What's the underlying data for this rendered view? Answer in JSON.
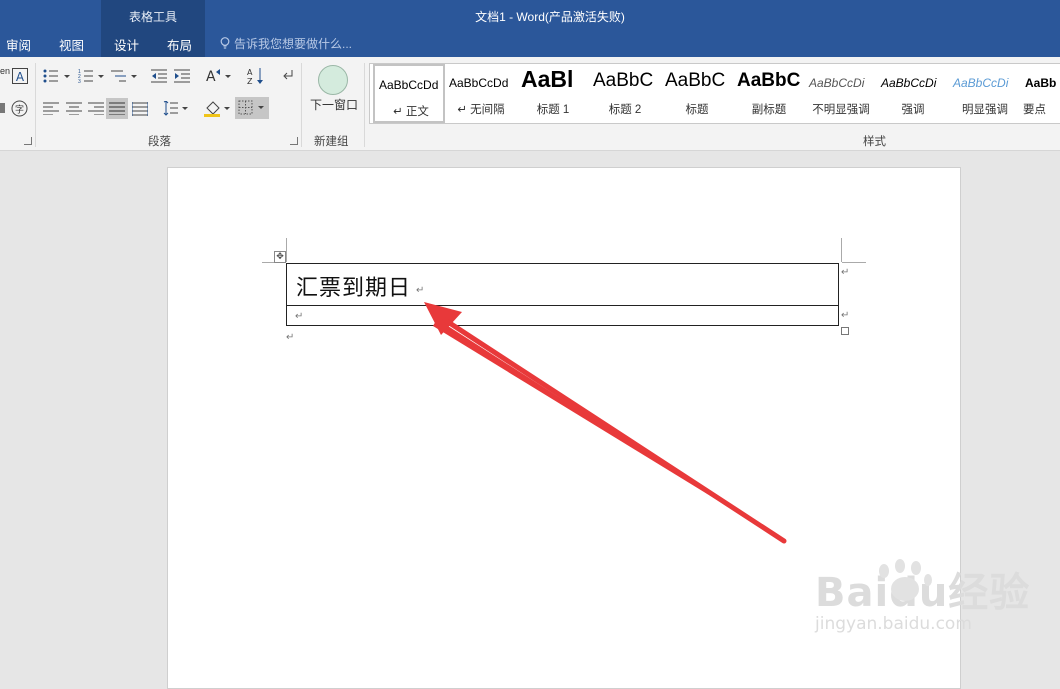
{
  "window": {
    "title": "文档1 - Word(产品激活失败)",
    "context_group": "表格工具"
  },
  "tabs": [
    {
      "label": "审阅"
    },
    {
      "label": "视图"
    },
    {
      "label": "设计"
    },
    {
      "label": "布局"
    }
  ],
  "tell_me": {
    "placeholder": "告诉我您想要做什么..."
  },
  "ribbon": {
    "paragraph_group": "段落",
    "new_group": "新建组",
    "next_window_button": "下一窗口",
    "styles_group": "样式",
    "font_partial_label": "en",
    "styles": [
      {
        "sample": "AaBbCcDd",
        "name": "↵ 正文",
        "selected": true
      },
      {
        "sample": "AaBbCcDd",
        "name": "↵ 无间隔"
      },
      {
        "sample": "AaBl",
        "name": "标题 1"
      },
      {
        "sample": "AaBbC",
        "name": "标题 2"
      },
      {
        "sample": "AaBbC",
        "name": "标题"
      },
      {
        "sample": "AaBbC",
        "name": "副标题"
      },
      {
        "sample": "AaBbCcDi",
        "name": "不明显强调"
      },
      {
        "sample": "AaBbCcDi",
        "name": "强调"
      },
      {
        "sample": "AaBbCcDi",
        "name": "明显强调"
      },
      {
        "sample": "AaBb",
        "name": "要点"
      }
    ]
  },
  "document": {
    "table_cell_text": "汇票到期日",
    "paragraph_mark": "↵",
    "move_handle": "✥"
  },
  "watermark": {
    "brand": "Baidu经验",
    "url": "jingyan.baidu.com"
  },
  "colors": {
    "title_bar": "#2b579a",
    "context_group": "#21477f",
    "annotation_arrow": "#e8393a"
  }
}
